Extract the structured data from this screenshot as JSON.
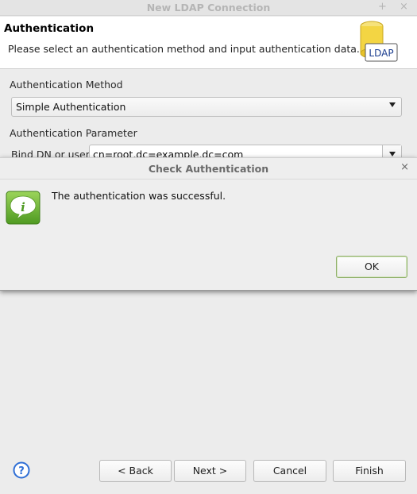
{
  "window": {
    "title": "New LDAP Connection",
    "pin_glyph": "+",
    "close_glyph": "×"
  },
  "banner": {
    "title": "Authentication",
    "description": "Please select an authentication method and input authentication data.",
    "logo_text": "LDAP"
  },
  "form": {
    "method_label": "Authentication Method",
    "method_value": "Simple Authentication",
    "parameter_label": "Authentication Parameter",
    "bind_dn_label": "Bind DN or user:",
    "bind_dn_value": "cn=root,dc=example,dc=com"
  },
  "dialog": {
    "title": "Check Authentication",
    "close_glyph": "×",
    "message": "The authentication was successful.",
    "ok_label": "OK",
    "icon_letter": "i"
  },
  "footer": {
    "back_label": "< Back",
    "next_label": "Next >",
    "cancel_label": "Cancel",
    "finish_label": "Finish",
    "help_glyph": "?"
  },
  "colors": {
    "info_icon_green": "#6fb63a",
    "help_icon_blue": "#2f6fd6",
    "ok_border": "#8fb06a"
  }
}
